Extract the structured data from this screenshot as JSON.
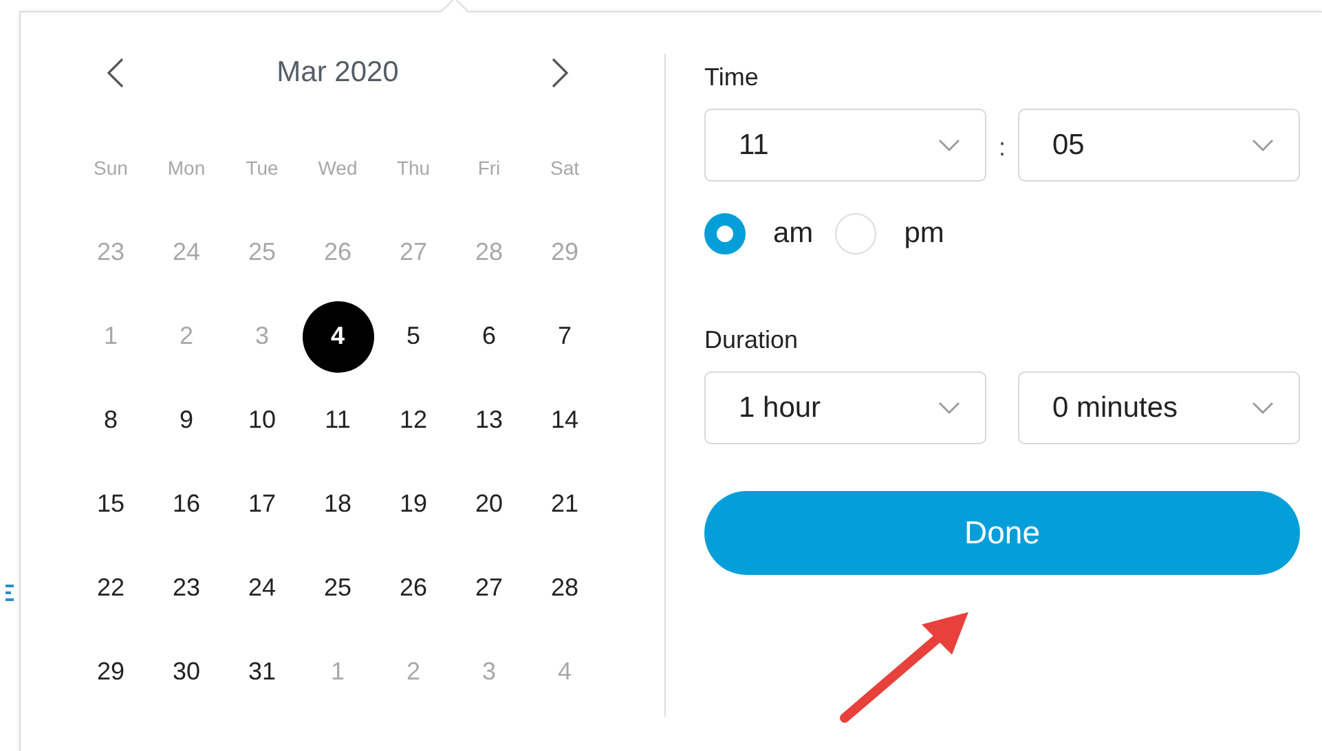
{
  "calendar": {
    "month_title": "Mar 2020",
    "weekdays": [
      "Sun",
      "Mon",
      "Tue",
      "Wed",
      "Thu",
      "Fri",
      "Sat"
    ],
    "weeks": [
      [
        {
          "day": "23",
          "muted": true,
          "selected": false
        },
        {
          "day": "24",
          "muted": true,
          "selected": false
        },
        {
          "day": "25",
          "muted": true,
          "selected": false
        },
        {
          "day": "26",
          "muted": true,
          "selected": false
        },
        {
          "day": "27",
          "muted": true,
          "selected": false
        },
        {
          "day": "28",
          "muted": true,
          "selected": false
        },
        {
          "day": "29",
          "muted": true,
          "selected": false
        }
      ],
      [
        {
          "day": "1",
          "muted": true,
          "selected": false
        },
        {
          "day": "2",
          "muted": true,
          "selected": false
        },
        {
          "day": "3",
          "muted": true,
          "selected": false
        },
        {
          "day": "4",
          "muted": false,
          "selected": true
        },
        {
          "day": "5",
          "muted": false,
          "selected": false
        },
        {
          "day": "6",
          "muted": false,
          "selected": false
        },
        {
          "day": "7",
          "muted": false,
          "selected": false
        }
      ],
      [
        {
          "day": "8",
          "muted": false,
          "selected": false
        },
        {
          "day": "9",
          "muted": false,
          "selected": false
        },
        {
          "day": "10",
          "muted": false,
          "selected": false
        },
        {
          "day": "11",
          "muted": false,
          "selected": false
        },
        {
          "day": "12",
          "muted": false,
          "selected": false
        },
        {
          "day": "13",
          "muted": false,
          "selected": false
        },
        {
          "day": "14",
          "muted": false,
          "selected": false
        }
      ],
      [
        {
          "day": "15",
          "muted": false,
          "selected": false
        },
        {
          "day": "16",
          "muted": false,
          "selected": false
        },
        {
          "day": "17",
          "muted": false,
          "selected": false
        },
        {
          "day": "18",
          "muted": false,
          "selected": false
        },
        {
          "day": "19",
          "muted": false,
          "selected": false
        },
        {
          "day": "20",
          "muted": false,
          "selected": false
        },
        {
          "day": "21",
          "muted": false,
          "selected": false
        }
      ],
      [
        {
          "day": "22",
          "muted": false,
          "selected": false
        },
        {
          "day": "23",
          "muted": false,
          "selected": false
        },
        {
          "day": "24",
          "muted": false,
          "selected": false
        },
        {
          "day": "25",
          "muted": false,
          "selected": false
        },
        {
          "day": "26",
          "muted": false,
          "selected": false
        },
        {
          "day": "27",
          "muted": false,
          "selected": false
        },
        {
          "day": "28",
          "muted": false,
          "selected": false
        }
      ],
      [
        {
          "day": "29",
          "muted": false,
          "selected": false
        },
        {
          "day": "30",
          "muted": false,
          "selected": false
        },
        {
          "day": "31",
          "muted": false,
          "selected": false
        },
        {
          "day": "1",
          "muted": true,
          "selected": false
        },
        {
          "day": "2",
          "muted": true,
          "selected": false
        },
        {
          "day": "3",
          "muted": true,
          "selected": false
        },
        {
          "day": "4",
          "muted": true,
          "selected": false
        }
      ]
    ]
  },
  "time": {
    "label": "Time",
    "hour": "11",
    "separator": ":",
    "minute": "05",
    "meridiem": [
      {
        "label": "am",
        "selected": true
      },
      {
        "label": "pm",
        "selected": false
      }
    ]
  },
  "duration": {
    "label": "Duration",
    "hours": "1 hour",
    "minutes": "0 minutes"
  },
  "done_button": "Done"
}
